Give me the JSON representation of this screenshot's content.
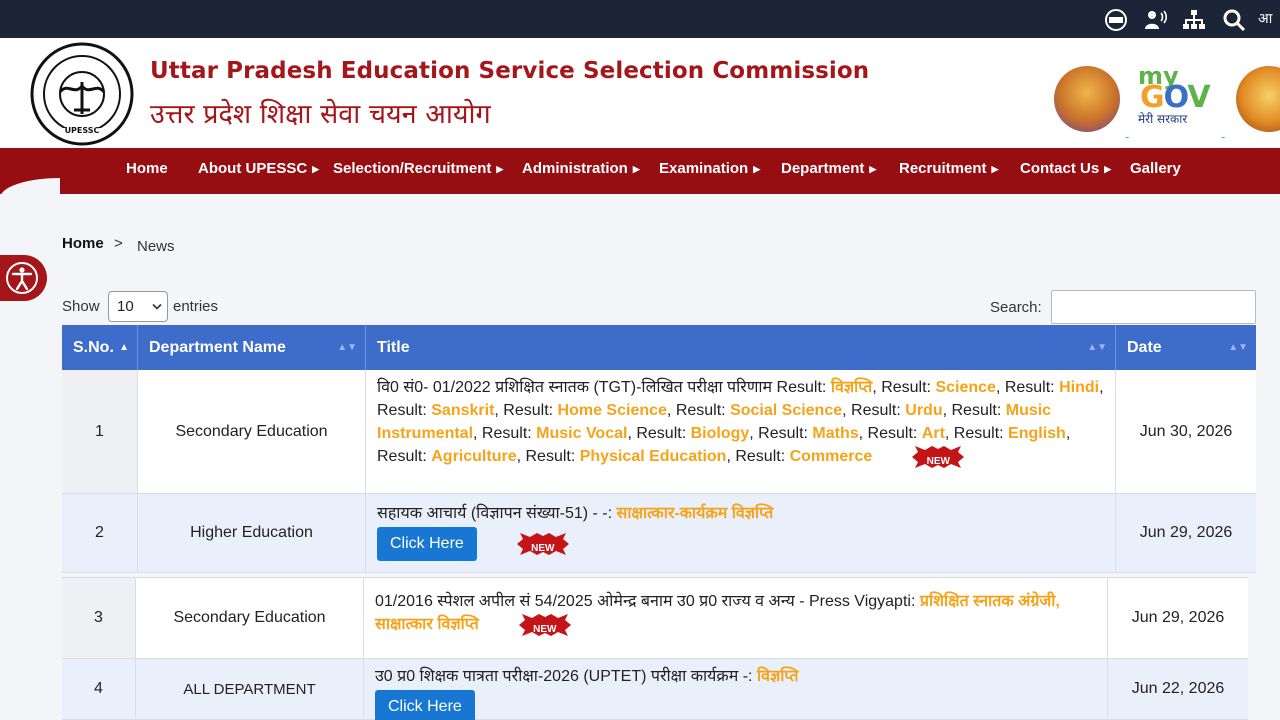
{
  "topbar": {
    "lang_label": "आ"
  },
  "header": {
    "title_en": "Uttar Pradesh Education Service Selection Commission",
    "title_hi": "उत्तर प्रदेश शिक्षा सेवा चयन आयोग",
    "emblem_text": "UPESSC",
    "mygov": {
      "my": "my",
      "gov_g": "G",
      "gov_o": "O",
      "gov_v": "V",
      "sub": "मेरी सरकार"
    }
  },
  "nav": [
    {
      "label": "Home",
      "caret": ""
    },
    {
      "label": "About UPESSC",
      "caret": "▶"
    },
    {
      "label": "Selection/Recruitment",
      "caret": "▶"
    },
    {
      "label": "Administration",
      "caret": "▶"
    },
    {
      "label": "Examination",
      "caret": "▶"
    },
    {
      "label": "Department",
      "caret": "▶"
    },
    {
      "label": "Recruitment",
      "caret": "▶"
    },
    {
      "label": "Contact Us",
      "caret": "▶"
    },
    {
      "label": "Gallery",
      "caret": ""
    }
  ],
  "breadcrumb": {
    "home": "Home",
    "sep": ">",
    "current": "News"
  },
  "table_controls": {
    "show": "Show",
    "page_size": "10",
    "entries": "entries",
    "search": "Search:"
  },
  "columns": [
    "S.No.",
    "Department Name",
    "Title",
    "Date"
  ],
  "new_label": "NEW",
  "rows": [
    {
      "sno": "1",
      "dept": "Secondary Education",
      "title_prefix": "वि0 सं0- 01/2022 प्रशिक्षित स्नातक (TGT)-लिखित परीक्षा परिणाम Result: ",
      "links": [
        {
          "pre": "",
          "link": "विज्ञप्ति"
        },
        {
          "pre": ", Result: ",
          "link": "Science"
        },
        {
          "pre": ", Result: ",
          "link": "Hindi"
        },
        {
          "pre": ", Result: ",
          "link": "Sanskrit"
        },
        {
          "pre": ", Result: ",
          "link": "Home Science"
        },
        {
          "pre": ", Result: ",
          "link": "Social Science"
        },
        {
          "pre": ", Result: ",
          "link": "Urdu"
        },
        {
          "pre": ", Result: ",
          "link": "Music Instrumental"
        },
        {
          "pre": ", Result: ",
          "link": "Music Vocal"
        },
        {
          "pre": ", Result: ",
          "link": "Biology"
        },
        {
          "pre": ", Result: ",
          "link": "Maths"
        },
        {
          "pre": ", Result: ",
          "link": "Art"
        },
        {
          "pre": ", Result: ",
          "link": "English"
        },
        {
          "pre": ", Result: ",
          "link": "Agriculture"
        },
        {
          "pre": ", Result: ",
          "link": "Physical Education"
        },
        {
          "pre": ", Result: ",
          "link": "Commerce"
        }
      ],
      "date": "Jun 30, 2026"
    },
    {
      "sno": "2",
      "dept": "Higher Education",
      "title_prefix": "सहायक आचार्य (विज्ञापन संख्या-51) - -: ",
      "link": "साक्षात्कार-कार्यक्रम विज्ञप्ति",
      "button": "Click Here",
      "date": "Jun 29, 2026"
    },
    {
      "sno": "3",
      "dept": "Secondary Education",
      "title_prefix": "01/2016 स्पेशल अपील सं 54/2025 ओमेन्द्र बनाम उ0 प्र0 राज्य व अन्य - Press Vigyapti: ",
      "link": "प्रशिक्षित स्नातक अंग्रेजी, साक्षात्कार विज्ञप्ति",
      "date": "Jun 29, 2026"
    },
    {
      "sno": "4",
      "dept": "ALL DEPARTMENT",
      "title_prefix": "उ0 प्र0 शिक्षक पात्रता परीक्षा-2026 (UPTET) परीक्षा कार्यक्रम -: ",
      "link": "विज्ञप्ति",
      "button": "Click Here",
      "date": "Jun 22, 2026"
    }
  ]
}
